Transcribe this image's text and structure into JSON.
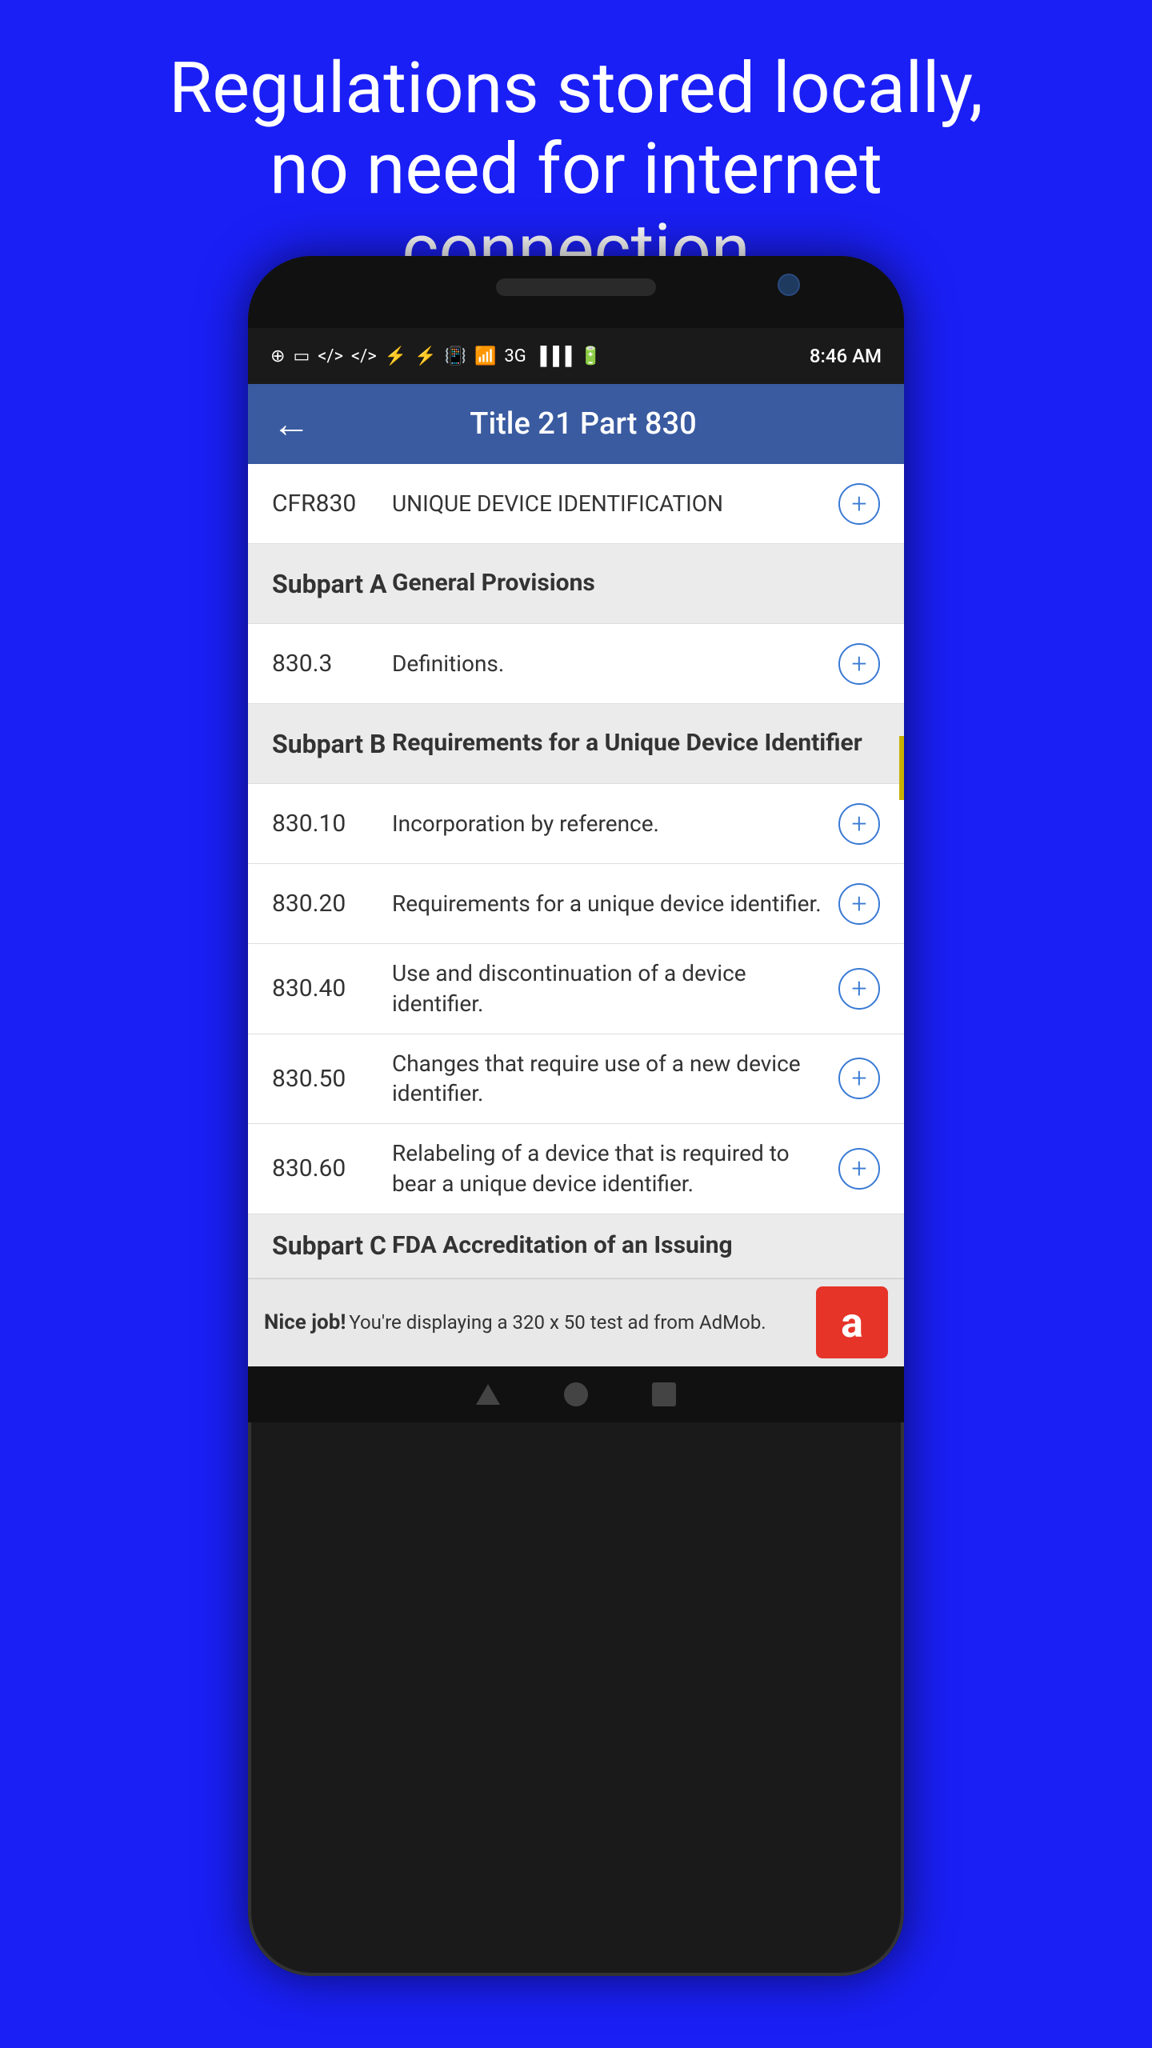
{
  "hero": {
    "line1": "Regulations stored locally,",
    "line2": "no need for internet",
    "line3": "connection"
  },
  "status_bar": {
    "time": "8:46 AM",
    "signal": "●●●●",
    "wifi": "wifi",
    "battery": "battery"
  },
  "header": {
    "back_label": "←",
    "title": "Title 21 Part 830"
  },
  "rows": [
    {
      "number": "CFR830",
      "title": "UNIQUE DEVICE IDENTIFICATION",
      "bold_title": false,
      "bold_number": false,
      "has_plus": true,
      "subpart": false
    },
    {
      "number": "Subpart A",
      "title": "General Provisions",
      "bold_title": true,
      "bold_number": true,
      "has_plus": false,
      "subpart": true
    },
    {
      "number": "830.3",
      "title": "Definitions.",
      "bold_title": false,
      "bold_number": false,
      "has_plus": true,
      "subpart": false
    },
    {
      "number": "Subpart B",
      "title": "Requirements for a Unique Device Identifier",
      "bold_title": true,
      "bold_number": true,
      "has_plus": false,
      "subpart": true
    },
    {
      "number": "830.10",
      "title": "Incorporation by reference.",
      "bold_title": false,
      "bold_number": false,
      "has_plus": true,
      "subpart": false
    },
    {
      "number": "830.20",
      "title": "Requirements for a unique device identifier.",
      "bold_title": false,
      "bold_number": false,
      "has_plus": true,
      "subpart": false
    },
    {
      "number": "830.40",
      "title": "Use and discontinuation of a device identifier.",
      "bold_title": false,
      "bold_number": false,
      "has_plus": true,
      "subpart": false
    },
    {
      "number": "830.50",
      "title": "Changes that require use of a new device identifier.",
      "bold_title": false,
      "bold_number": false,
      "has_plus": true,
      "subpart": false
    },
    {
      "number": "830.60",
      "title": "Relabeling of a device that is required to bear a unique device identifier.",
      "bold_title": false,
      "bold_number": false,
      "has_plus": true,
      "subpart": false
    },
    {
      "number": "Subpart C",
      "title": "FDA Accreditation of an Issuing",
      "bold_title": true,
      "bold_number": true,
      "has_plus": false,
      "subpart": true,
      "partial": true
    }
  ],
  "ad": {
    "bold_text": "Nice job!",
    "normal_text": " You're displaying a 320 x 50 test ad from AdMob.",
    "logo_char": "a"
  },
  "colors": {
    "header_bg": "#3a5ba0",
    "plus_color": "#3a7bd5",
    "subpart_bg": "#ebebeb"
  }
}
